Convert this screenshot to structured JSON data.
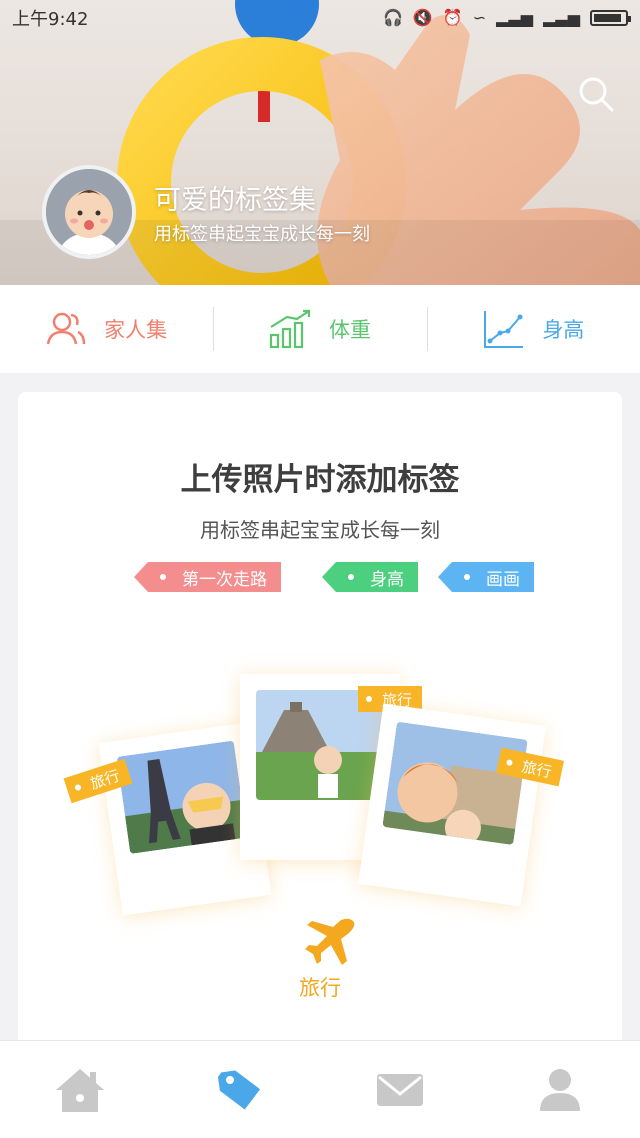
{
  "status_bar": {
    "time": "上午9:42"
  },
  "hero": {
    "title": "可爱的标签集",
    "subtitle": "用标签串起宝宝成长每一刻",
    "search_icon": "search-icon",
    "avatar_icon": "baby-avatar"
  },
  "quick_nav": {
    "items": [
      {
        "label": "家人集",
        "icon": "family-icon",
        "color": "#f07f6e"
      },
      {
        "label": "体重",
        "icon": "weight-chart-icon",
        "color": "#5bc56d"
      },
      {
        "label": "身高",
        "icon": "height-chart-icon",
        "color": "#4aa8e8"
      }
    ]
  },
  "card": {
    "title": "上传照片时添加标签",
    "subtitle": "用标签串起宝宝成长每一刻",
    "tags": [
      {
        "label": "第一次走路",
        "color": "#f48d8d"
      },
      {
        "label": "身高",
        "color": "#4cd080"
      },
      {
        "label": "画画",
        "color": "#5db4f3"
      }
    ],
    "photo_tags": [
      "旅行",
      "旅行",
      "旅行"
    ],
    "category_icon": "airplane-icon",
    "category_label": "旅行",
    "category_color": "#f3a820"
  },
  "tab_bar": {
    "tabs": [
      {
        "icon": "home-icon",
        "active": false
      },
      {
        "icon": "tag-icon",
        "active": true
      },
      {
        "icon": "mail-icon",
        "active": false
      },
      {
        "icon": "profile-icon",
        "active": false
      }
    ],
    "active_color": "#4aa8e8",
    "inactive_color": "#c8c8c8"
  }
}
